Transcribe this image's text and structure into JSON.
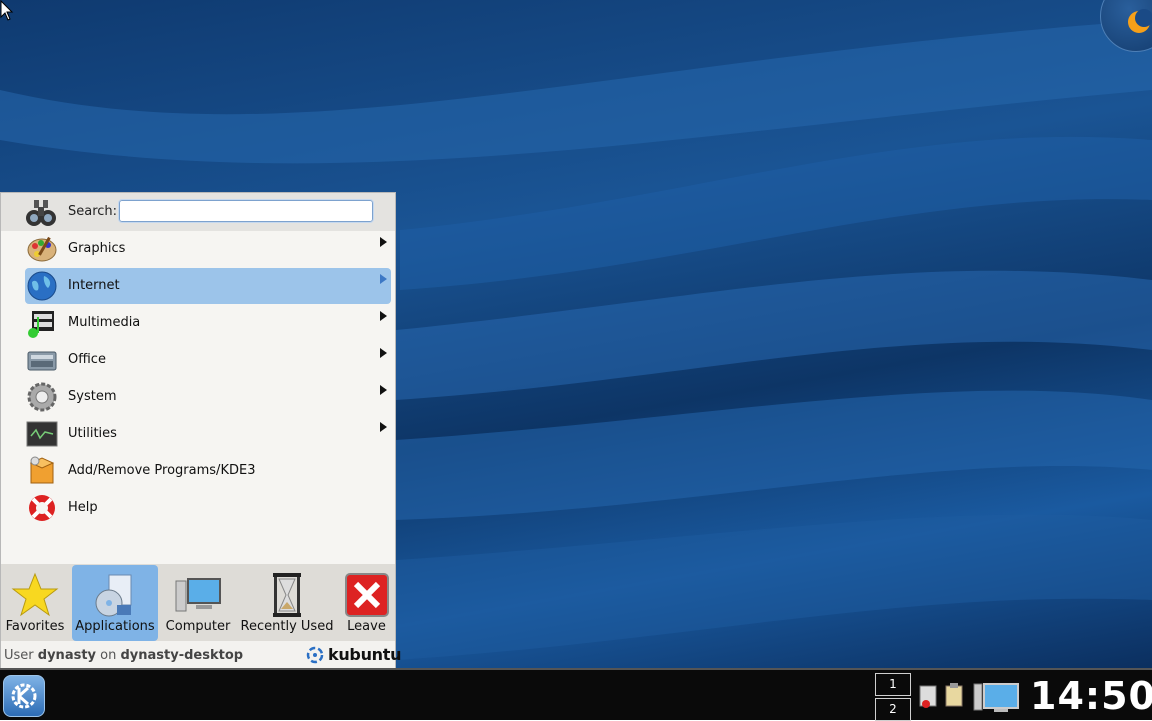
{
  "search": {
    "label": "Search:",
    "value": ""
  },
  "menu_items": [
    {
      "label": "Graphics",
      "icon": "graphics-icon",
      "submenu": true
    },
    {
      "label": "Internet",
      "icon": "internet-icon",
      "submenu": true,
      "selected": true
    },
    {
      "label": "Multimedia",
      "icon": "multimedia-icon",
      "submenu": true
    },
    {
      "label": "Office",
      "icon": "office-icon",
      "submenu": true
    },
    {
      "label": "System",
      "icon": "system-icon",
      "submenu": true
    },
    {
      "label": "Utilities",
      "icon": "utilities-icon",
      "submenu": true
    },
    {
      "label": "Add/Remove Programs/KDE3",
      "icon": "add-remove-programs-icon",
      "submenu": false
    },
    {
      "label": "Help",
      "icon": "help-icon",
      "submenu": false
    }
  ],
  "tabs": [
    {
      "label": "Favorites",
      "icon": "star-icon"
    },
    {
      "label": "Applications",
      "icon": "applications-icon",
      "active": true
    },
    {
      "label": "Computer",
      "icon": "computer-icon"
    },
    {
      "label": "Recently Used",
      "icon": "hourglass-icon"
    },
    {
      "label": "Leave",
      "icon": "leave-icon"
    }
  ],
  "status": {
    "prefix": "User",
    "user": "dynasty",
    "on": "on",
    "host": "dynasty-desktop",
    "brand": "kubuntu"
  },
  "pager": {
    "desktop1": "1",
    "desktop2": "2"
  },
  "clock": "14:50",
  "colors": {
    "selection": "#9cc4ea",
    "active_tab": "#7fb3e6",
    "panel": "#0a0a0a"
  }
}
